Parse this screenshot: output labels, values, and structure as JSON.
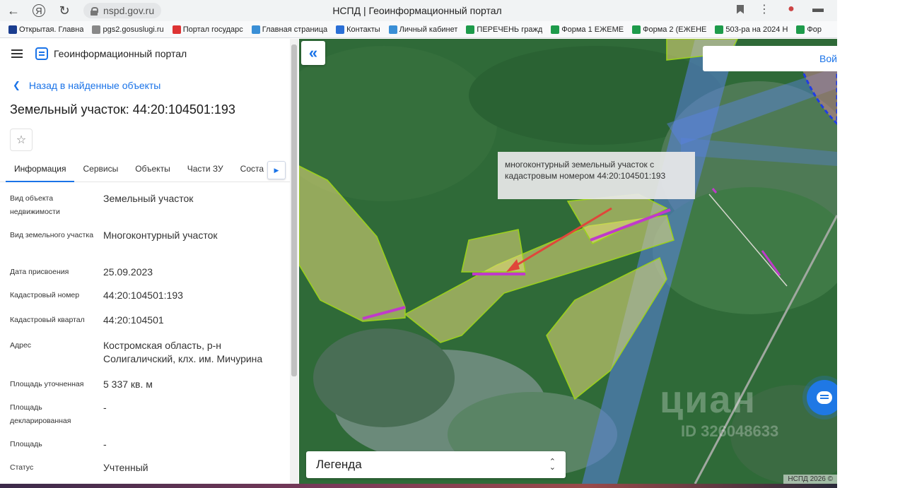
{
  "browser": {
    "url": "nspd.gov.ru",
    "title": "НСПД | Геоинформационный портал",
    "bookmarks": [
      {
        "label": "Открытая. Главна",
        "color": "#1a3d8f"
      },
      {
        "label": "pgs2.gosuslugi.ru",
        "color": "#888888"
      },
      {
        "label": "Портал государс",
        "color": "#d33"
      },
      {
        "label": "Главная страница",
        "color": "#3a8fd6"
      },
      {
        "label": "Контакты",
        "color": "#2a6fd6"
      },
      {
        "label": "Личный кабинет",
        "color": "#3a8fd6"
      },
      {
        "label": "ПЕРЕЧЕНЬ гражд",
        "color": "#1e9b4b"
      },
      {
        "label": "Форма 1 ЕЖЕМЕ",
        "color": "#1e9b4b"
      },
      {
        "label": "Форма 2 (ЕЖЕНЕ",
        "color": "#1e9b4b"
      },
      {
        "label": "503-ра на 2024 Н",
        "color": "#1e9b4b"
      },
      {
        "label": "Фор",
        "color": "#1e9b4b"
      }
    ]
  },
  "panel": {
    "portal_name": "Геоинформационный портал",
    "back_label": "Назад в найденные объекты",
    "title": "Земельный участок: 44:20:104501:193",
    "tabs": [
      "Информация",
      "Сервисы",
      "Объекты",
      "Части ЗУ",
      "Соста"
    ],
    "properties": [
      {
        "key": "Вид объекта недвижимости",
        "value": "Земельный участок"
      },
      {
        "key": "Вид земельного участка",
        "value": "Многоконтурный участок"
      },
      {
        "key": "Дата присвоения",
        "value": "25.09.2023"
      },
      {
        "key": "Кадастровый номер",
        "value": "44:20:104501:193"
      },
      {
        "key": "Кадастровый квартал",
        "value": "44:20:104501"
      },
      {
        "key": "Адрес",
        "value": "Костромская область, р-н Солигаличский, клх. им. Мичурина"
      },
      {
        "key": "Площадь уточненная",
        "value": "5 337 кв. м"
      },
      {
        "key": "Площадь декларированная",
        "value": "-"
      },
      {
        "key": "Площадь",
        "value": "-"
      },
      {
        "key": "Статус",
        "value": "Учтенный"
      }
    ]
  },
  "map": {
    "search_placeholder": "Вой",
    "annotation": "многоконтурный земельный участок с кадастровым номером 44:20:104501:193",
    "legend_label": "Легенда",
    "watermark": "циан",
    "watermark_id": "ID 326048633",
    "copyright": "НСПД 2026 ©"
  },
  "colors": {
    "accent": "#1a73e8",
    "parcel_fill": "#e8dd7a",
    "parcel_highlight": "#c03acb",
    "arrow": "#e0463a"
  }
}
